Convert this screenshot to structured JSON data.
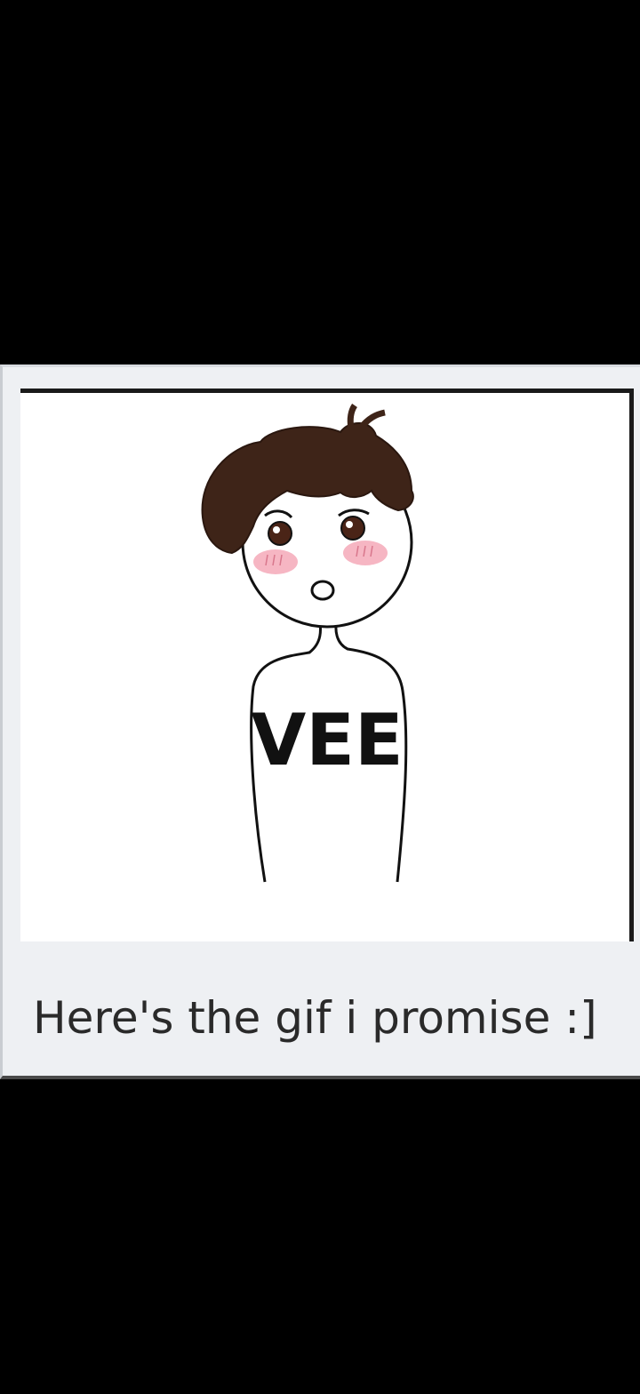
{
  "post": {
    "shirt_text": "VEE",
    "caption": "Here's the gif i promise :]"
  },
  "colors": {
    "background": "#000000",
    "card": "#eef0f3",
    "frame": "#ffffff",
    "hair": "#3e2418",
    "blush": "#f4a9b8",
    "text": "#2a2a2a"
  }
}
